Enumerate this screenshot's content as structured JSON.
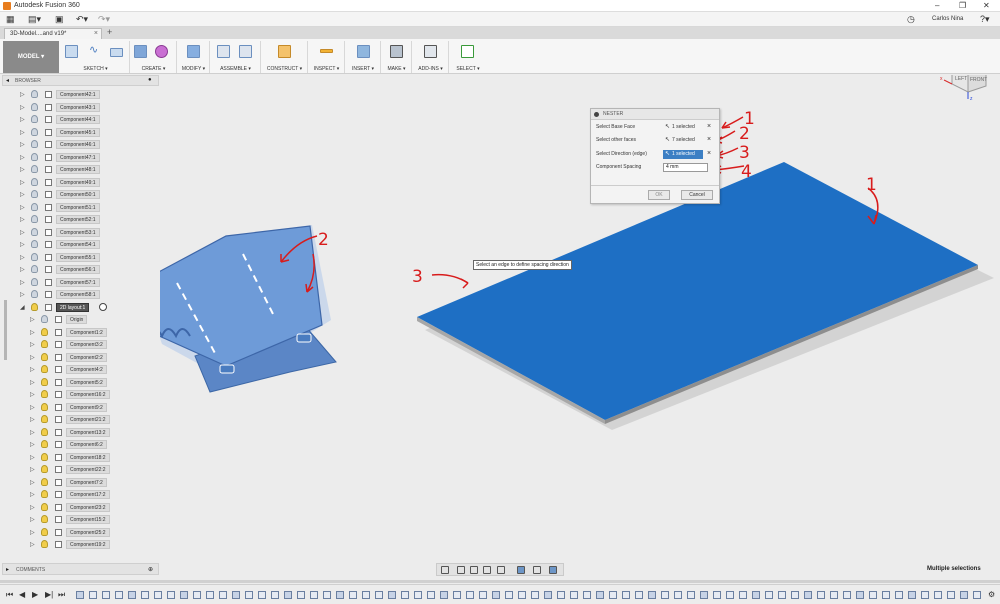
{
  "app": {
    "title": "Autodesk Fusion 360"
  },
  "qat": {
    "user": "Carlos Nina"
  },
  "tab": {
    "label": "3D-Model....and v19*"
  },
  "workspace": {
    "label": "MODEL ▾"
  },
  "toolbar": {
    "groups": [
      {
        "label": "SKETCH ▾"
      },
      {
        "label": "CREATE ▾"
      },
      {
        "label": "MODIFY ▾"
      },
      {
        "label": "ASSEMBLE ▾"
      },
      {
        "label": "CONSTRUCT ▾"
      },
      {
        "label": "INSPECT ▾"
      },
      {
        "label": "INSERT ▾"
      },
      {
        "label": "MAKE ▾"
      },
      {
        "label": "ADD-INS ▾"
      },
      {
        "label": "SELECT ▾"
      }
    ]
  },
  "browser": {
    "title": "BROWSER",
    "top_items": [
      "Component42:1",
      "Component43:1",
      "Component44:1",
      "Component45:1",
      "Component46:1",
      "Component47:1",
      "Component48:1",
      "Component49:1",
      "Component50:1",
      "Component51:1",
      "Component52:1",
      "Component53:1",
      "Component54:1",
      "Component55:1",
      "Component56:1",
      "Component57:1",
      "Component58:1"
    ],
    "layout": "2D layout:1",
    "origin": "Origin",
    "sub_items": [
      "Component1:2",
      "Component3:2",
      "Component2:2",
      "Component4:2",
      "Component5:2",
      "Component16:2",
      "Component9:2",
      "Component21:2",
      "Component13:2",
      "Component6:2",
      "Component18:2",
      "Component22:2",
      "Component7:2",
      "Component17:2",
      "Component23:2",
      "Component15:2",
      "Component25:2",
      "Component19:2"
    ]
  },
  "nester": {
    "title": "NESTER",
    "rows": [
      {
        "label": "Select Base Face",
        "value": "1 selected"
      },
      {
        "label": "Select other faces",
        "value": "7 selected"
      },
      {
        "label": "Select Direction (edge)",
        "value": "1 selected"
      },
      {
        "label": "Component Spacing",
        "value": "4 mm"
      }
    ],
    "ok": "OK",
    "cancel": "Cancel"
  },
  "tooltip": "Select an edge to define spacing direction",
  "annotations": {
    "a1": "1",
    "a2": "2",
    "a3": "3",
    "a4": "4"
  },
  "viewcube": {
    "left": "LEFT",
    "front": "FRONT",
    "axis_x": "x",
    "axis_z": "z"
  },
  "comments": {
    "title": "COMMENTS"
  },
  "status": {
    "selection": "Multiple selections"
  },
  "colors": {
    "plate": "#1e6fc4",
    "part": "#6f9ad6",
    "annotation": "#d81c1c",
    "selection": "#3c7fc4"
  }
}
